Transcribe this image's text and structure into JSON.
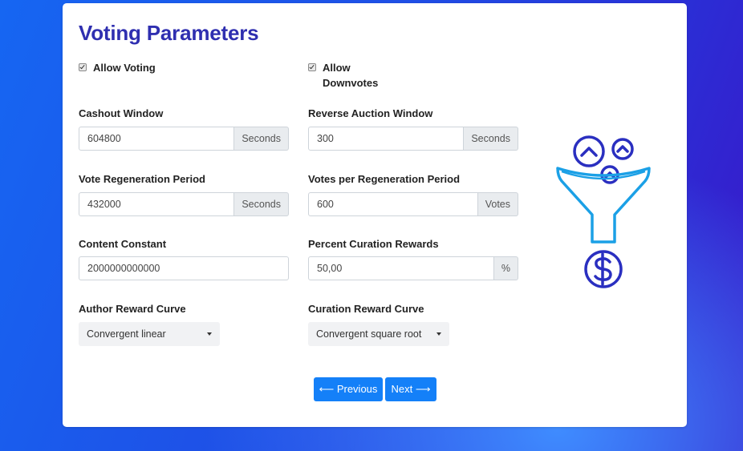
{
  "page": {
    "title": "Voting Parameters"
  },
  "checkboxes": {
    "allow_voting": {
      "label": "Allow Voting",
      "checked": true
    },
    "allow_downvotes": {
      "label_line1": "Allow",
      "label_line2": "Downvotes",
      "checked": true
    }
  },
  "fields": {
    "cashout_window": {
      "label": "Cashout Window",
      "value": "604800",
      "unit": "Seconds"
    },
    "reverse_auction_window": {
      "label": "Reverse Auction Window",
      "value": "300",
      "unit": "Seconds"
    },
    "vote_regeneration_period": {
      "label": "Vote Regeneration Period",
      "value": "432000",
      "unit": "Seconds"
    },
    "votes_per_regeneration_period": {
      "label": "Votes per Regeneration Period",
      "value": "600",
      "unit": "Votes"
    },
    "content_constant": {
      "label": "Content Constant",
      "value": "2000000000000"
    },
    "percent_curation_rewards": {
      "label": "Percent Curation Rewards",
      "value": "50,00",
      "unit": "%"
    }
  },
  "selects": {
    "author_reward_curve": {
      "label": "Author Reward Curve",
      "value": "Convergent linear"
    },
    "curation_reward_curve": {
      "label": "Curation Reward Curve",
      "value": "Convergent square root"
    }
  },
  "buttons": {
    "previous": "⟵ Previous",
    "next": "Next ⟶"
  },
  "colors": {
    "accent": "#1480f8",
    "title": "#2f2fb0",
    "funnel": "#1ba0e6",
    "icon": "#2a2fc0"
  },
  "icons": {
    "illustration": "funnel-coins-dollar-icon"
  }
}
